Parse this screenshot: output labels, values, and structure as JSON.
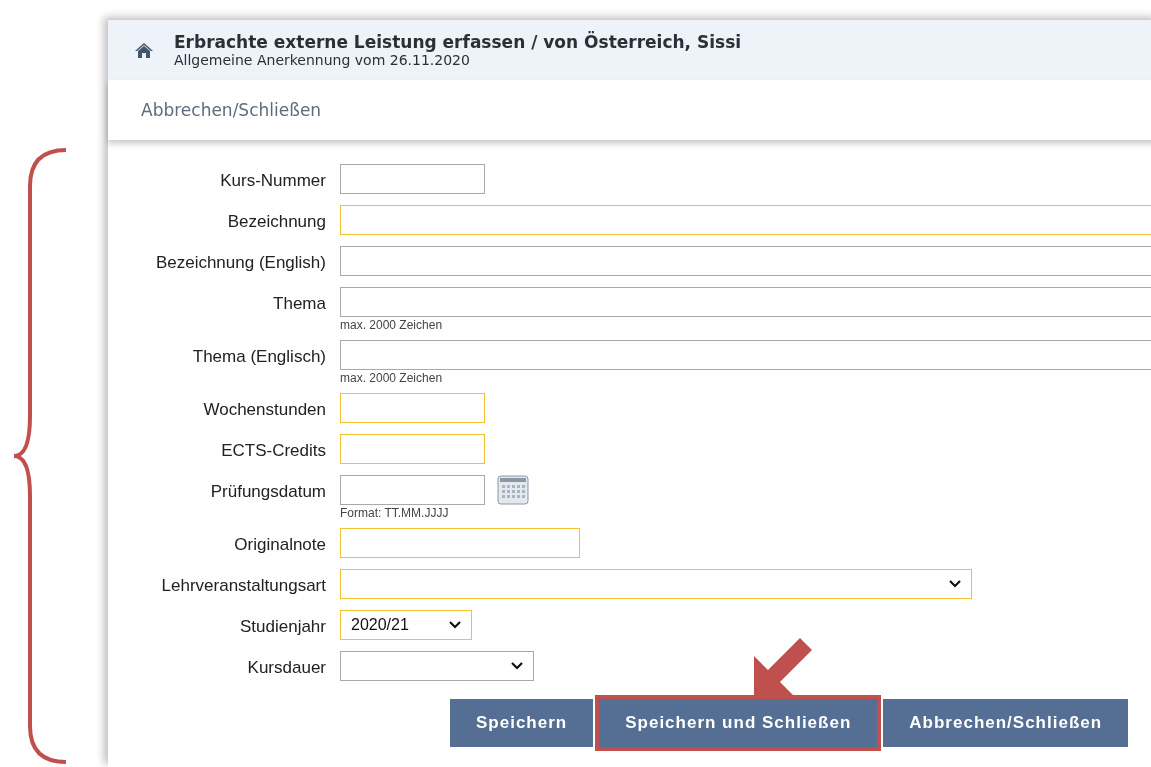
{
  "header": {
    "title": "Erbrachte externe Leistung erfassen  / von Österreich, Sissi",
    "subtitle": "Allgemeine Anerkennung vom 26.11.2020"
  },
  "toolbar": {
    "link": "Abbrechen/Schließen"
  },
  "fields": [
    {
      "label": "Kurs-Nummer",
      "kind": "short",
      "required": false
    },
    {
      "label": "Bezeichnung",
      "kind": "long",
      "required": true
    },
    {
      "label": "Bezeichnung (English)",
      "kind": "long",
      "required": false
    },
    {
      "label": "Thema",
      "kind": "long",
      "required": false,
      "hint": "max. 2000 Zeichen"
    },
    {
      "label": "Thema (Englisch)",
      "kind": "long",
      "required": false,
      "hint": "max. 2000 Zeichen"
    },
    {
      "label": "Wochenstunden",
      "kind": "short",
      "required": true
    },
    {
      "label": "ECTS-Credits",
      "kind": "short",
      "required": true
    },
    {
      "label": "Prüfungsdatum",
      "kind": "date",
      "required": false,
      "hint": "Format: TT.MM.JJJJ"
    },
    {
      "label": "Originalnote",
      "kind": "medium",
      "required": true
    },
    {
      "label": "Lehrveranstaltungsart",
      "kind": "select-long",
      "required": true
    },
    {
      "label": "Studienjahr",
      "kind": "select-short",
      "required": true,
      "value": "2020/21"
    },
    {
      "label": "Kursdauer",
      "kind": "select-mid",
      "required": false
    }
  ],
  "buttons": [
    {
      "label": "Speichern",
      "highlighted": false
    },
    {
      "label": "Speichern und Schließen",
      "highlighted": true
    },
    {
      "label": "Abbrechen/Schließen",
      "highlighted": false
    }
  ]
}
